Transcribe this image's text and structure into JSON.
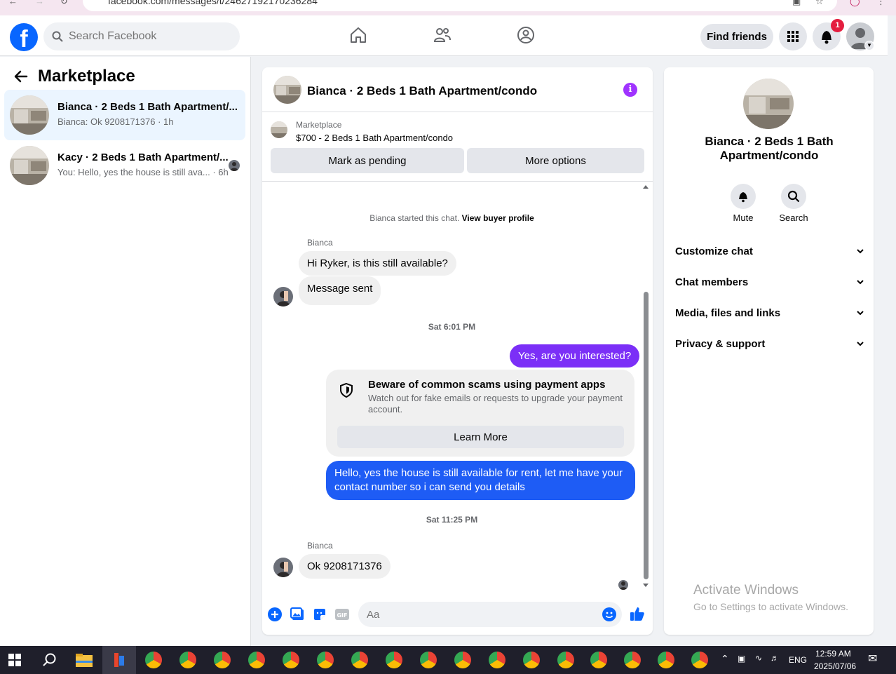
{
  "browser": {
    "url": "facebook.com/messages/t/24627192170236284"
  },
  "topbar": {
    "search_placeholder": "Search Facebook",
    "find_friends": "Find friends",
    "notification_count": "1",
    "accent": "#0866ff"
  },
  "left": {
    "title": "Marketplace",
    "conversations": [
      {
        "title": "Bianca · 2 Beds 1 Bath Apartment/...",
        "preview": "Bianca: Ok 9208171376 · 1h",
        "active": true
      },
      {
        "title": "Kacy · 2 Beds 1 Bath Apartment/...",
        "preview": "You: Hello, yes the house is still ava... · 6h",
        "active": false
      }
    ]
  },
  "chat": {
    "title": "Bianca · 2 Beds 1 Bath Apartment/condo",
    "listing_source": "Marketplace",
    "listing_summary": "$700 - 2 Beds 1 Bath Apartment/condo",
    "mark_pending": "Mark as pending",
    "more_options": "More options",
    "started_text": "Bianca started this chat.",
    "view_profile": "View buyer profile",
    "sender_name": "Bianca",
    "msg1": "Hi Ryker, is this still available?",
    "msg2": "Message sent",
    "time1": "Sat 6:01 PM",
    "out1": "Yes, are you interested?",
    "scam_title": "Beware of common scams using payment apps",
    "scam_body": "Watch out for fake emails or requests to upgrade your payment account.",
    "learn_more": "Learn More",
    "out2": "Hello, yes the house is still available for rent, let me have your contact number so i can send you details",
    "time2": "Sat 11:25 PM",
    "sender_name2": "Bianca",
    "msg3": "Ok 9208171376",
    "composer_placeholder": "Aa",
    "out_colors": {
      "purple": "#7b2ff7",
      "blue": "#1e5cf5"
    }
  },
  "right": {
    "name": "Bianca · 2 Beds 1 Bath Apartment/condo",
    "mute": "Mute",
    "search": "Search",
    "sections": [
      "Customize chat",
      "Chat members",
      "Media, files and links",
      "Privacy & support"
    ]
  },
  "watermark": {
    "line1": "Activate Windows",
    "line2": "Go to Settings to activate Windows."
  },
  "taskbar": {
    "lang": "ENG",
    "time": "12:59 AM",
    "date": "2025/07/06"
  }
}
